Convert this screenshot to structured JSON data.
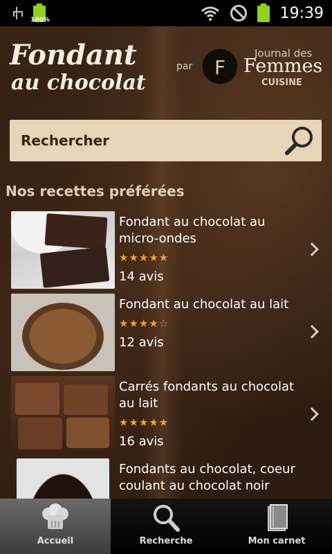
{
  "status_bar": {
    "battery_small_label": "100%",
    "clock": "19:39"
  },
  "header": {
    "title_line1": "Fondant",
    "title_line2": "au chocolat",
    "by_label": "par",
    "brand_top": "Journal des",
    "brand_main": "Femmes",
    "brand_bottom": "CUISINE"
  },
  "search": {
    "placeholder": "Rechercher",
    "icon": "search-icon"
  },
  "section": {
    "title": "Nos recettes préférées"
  },
  "recipes": [
    {
      "title": "Fondant au chocolat au micro-ondes",
      "rating": 5,
      "stars": "★★★★★",
      "reviews": "14 avis"
    },
    {
      "title": "Fondant au chocolat au lait",
      "rating": 4,
      "stars": "★★★★☆",
      "reviews": "12 avis"
    },
    {
      "title": "Carrés fondants au chocolat au lait",
      "rating": 5,
      "stars": "★★★★★",
      "reviews": "16 avis"
    },
    {
      "title": "Fondants au chocolat, coeur coulant au chocolat noir",
      "rating": null,
      "stars": "",
      "reviews": ""
    }
  ],
  "tabs": [
    {
      "label": "Accueil",
      "icon": "chef-hat-icon",
      "active": true
    },
    {
      "label": "Recherche",
      "icon": "search-icon",
      "active": false
    },
    {
      "label": "Mon carnet",
      "icon": "notebook-icon",
      "active": false
    }
  ],
  "colors": {
    "star": "#f2a03a",
    "search_bg": "#e7d4b9",
    "section_title": "#e0cfb7"
  }
}
